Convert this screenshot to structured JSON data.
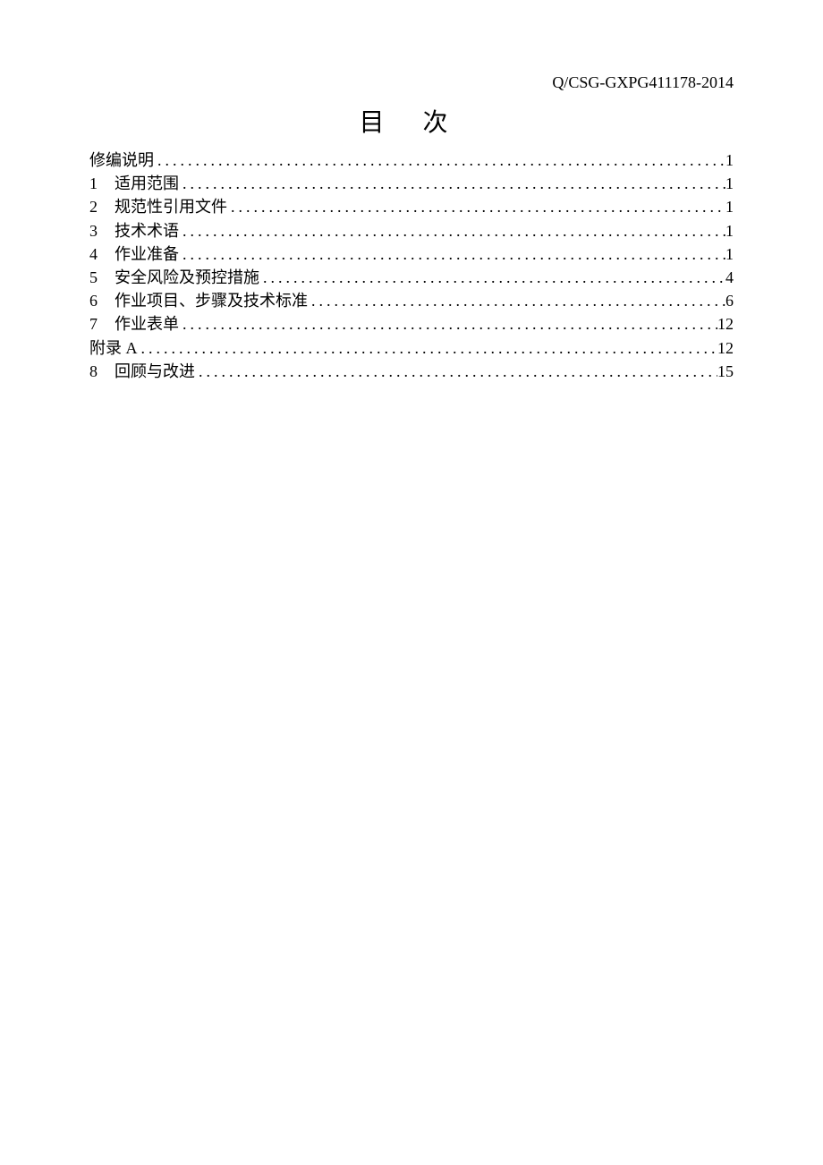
{
  "header_code": "Q/CSG-GXPG411178-2014",
  "title": "目 次",
  "toc": [
    {
      "num": "",
      "label": "修编说明",
      "page": "1"
    },
    {
      "num": "1",
      "label": "适用范围",
      "page": "1"
    },
    {
      "num": "2",
      "label": "规范性引用文件",
      "page": "1"
    },
    {
      "num": "3",
      "label": "技术术语",
      "page": "1"
    },
    {
      "num": "4",
      "label": "作业准备",
      "page": "1"
    },
    {
      "num": "5",
      "label": "安全风险及预控措施",
      "page": "4"
    },
    {
      "num": "6",
      "label": "作业项目、步骤及技术标准",
      "page": "6"
    },
    {
      "num": "7",
      "label": " 作业表单",
      "page": "12"
    },
    {
      "num": "",
      "label": "附录 A",
      "page": "12"
    },
    {
      "num": "8",
      "label": "回顾与改进",
      "page": "15"
    }
  ]
}
